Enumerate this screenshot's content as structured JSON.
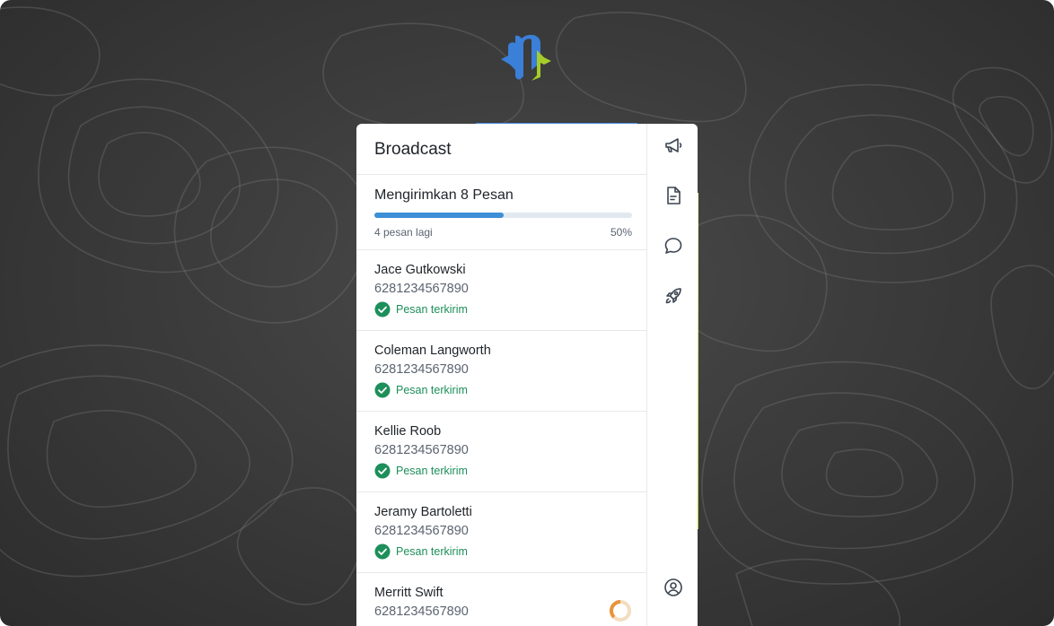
{
  "app": {
    "title": "Broadcast"
  },
  "progress": {
    "title": "Mengirimkan 8 Pesan",
    "remaining": "4 pesan lagi",
    "percent_label": "50%",
    "fraction": 0.5
  },
  "contacts": [
    {
      "name": "Jace Gutkowski",
      "phone": "6281234567890",
      "status": "Pesan terkirim"
    },
    {
      "name": "Coleman Langworth",
      "phone": "6281234567890",
      "status": "Pesan terkirim"
    },
    {
      "name": "Kellie Roob",
      "phone": "6281234567890",
      "status": "Pesan terkirim"
    },
    {
      "name": "Jeramy Bartoletti",
      "phone": "6281234567890",
      "status": "Pesan terkirim"
    },
    {
      "name": "Merritt Swift",
      "phone": "6281234567890",
      "status": ""
    }
  ],
  "rail": {
    "items": [
      "megaphone-icon",
      "document-icon",
      "chat-icon",
      "rocket-icon"
    ],
    "bottom": "user-circle-icon"
  },
  "colors": {
    "accent": "#3d8fd6",
    "success": "#1d8f5a",
    "pending": "#e8953a",
    "logo_blue": "#3a7fd8",
    "logo_green": "#a6cc2a"
  }
}
